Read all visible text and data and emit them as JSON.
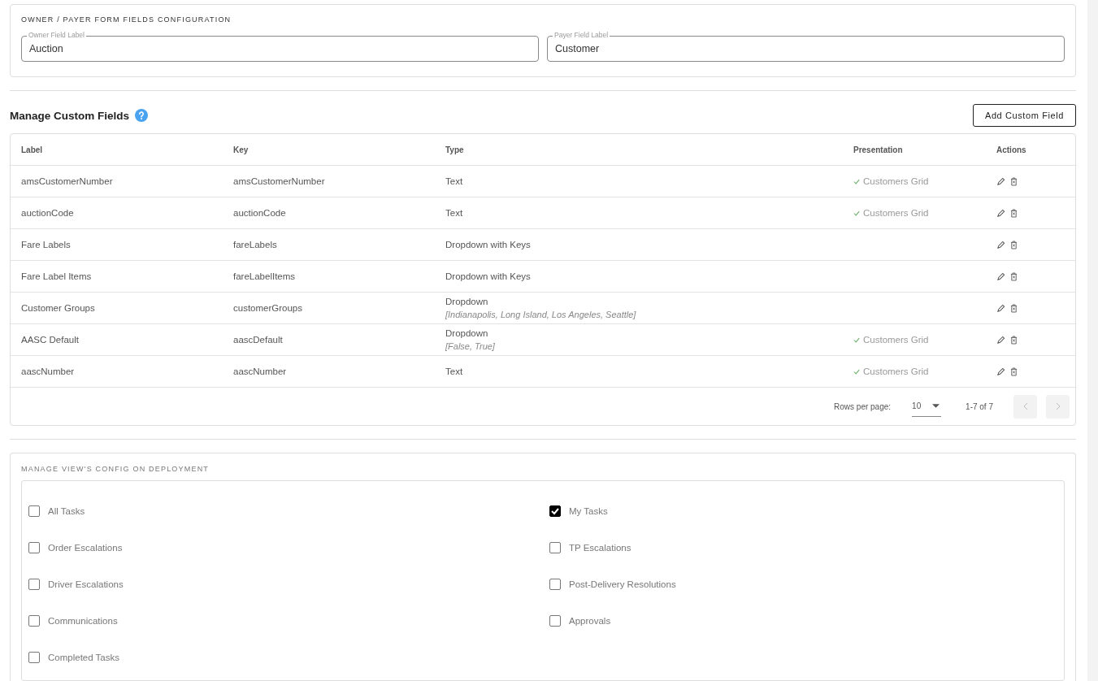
{
  "owner_payer_config": {
    "title": "OWNER / PAYER FORM FIELDS CONFIGURATION",
    "fields": [
      {
        "label": "Owner Field Label",
        "value": "Auction"
      },
      {
        "label": "Payer Field Label",
        "value": "Customer"
      }
    ]
  },
  "custom_fields": {
    "title": "Manage Custom Fields",
    "add_button": "Add Custom Field",
    "columns": [
      "Label",
      "Key",
      "Type",
      "Presentation",
      "Actions"
    ],
    "rows": [
      {
        "label": "amsCustomerNumber",
        "key": "amsCustomerNumber",
        "type": "Text",
        "presentation": "Customers Grid"
      },
      {
        "label": "auctionCode",
        "key": "auctionCode",
        "type": "Text",
        "presentation": "Customers Grid"
      },
      {
        "label": "Fare Labels",
        "key": "fareLabels",
        "type": "Dropdown with Keys"
      },
      {
        "label": "Fare Label Items",
        "key": "fareLabelItems",
        "type": "Dropdown with Keys"
      },
      {
        "label": "Customer Groups",
        "key": "customerGroups",
        "type": "Dropdown",
        "options": "[Indianapolis, Long Island, Los Angeles, Seattle]"
      },
      {
        "label": "AASC Default",
        "key": "aascDefault",
        "type": "Dropdown",
        "options": "[False, True]",
        "presentation": "Customers Grid"
      },
      {
        "label": "aascNumber",
        "key": "aascNumber",
        "type": "Text",
        "presentation": "Customers Grid"
      }
    ],
    "pagination": {
      "rows_per_page_label": "Rows per page:",
      "rows_per_page": "10",
      "range": "1-7 of 7"
    }
  },
  "views_config": {
    "title": "MANAGE VIEW'S CONFIG ON DEPLOYMENT",
    "options": [
      {
        "label": "All Tasks",
        "checked": false
      },
      {
        "label": "My Tasks",
        "checked": true
      },
      {
        "label": "Order Escalations",
        "checked": false
      },
      {
        "label": "TP Escalations",
        "checked": false
      },
      {
        "label": "Driver Escalations",
        "checked": false
      },
      {
        "label": "Post-Delivery Resolutions",
        "checked": false
      },
      {
        "label": "Communications",
        "checked": false
      },
      {
        "label": "Approvals",
        "checked": false
      },
      {
        "label": "Completed Tasks",
        "checked": false
      }
    ]
  }
}
